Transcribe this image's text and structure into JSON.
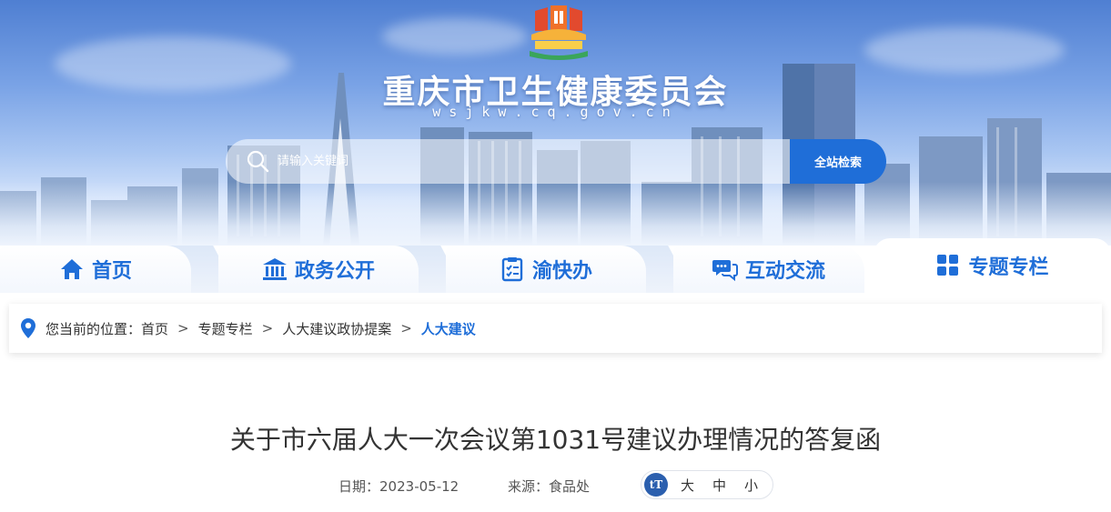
{
  "header": {
    "title": "重庆市卫生健康委员会",
    "domain": "wsjkw.cq.gov.cn"
  },
  "search": {
    "placeholder": "请输入关键词",
    "button_label": "全站检索"
  },
  "nav": {
    "items": [
      {
        "label": "首页",
        "icon": "home-icon"
      },
      {
        "label": "政务公开",
        "icon": "government-building-icon"
      },
      {
        "label": "渝快办",
        "icon": "checklist-icon"
      },
      {
        "label": "互动交流",
        "icon": "chat-bubbles-icon"
      },
      {
        "label": "专题专栏",
        "icon": "grid-icon",
        "active": true
      }
    ]
  },
  "breadcrumb": {
    "prefix": "您当前的位置：",
    "items": [
      "首页",
      "专题专栏",
      "人大建议政协提案",
      "人大建议"
    ],
    "separator": ">"
  },
  "article": {
    "title": "关于市六届人大一次会议第1031号建议办理情况的答复函",
    "date_label": "日期：",
    "date": "2023-05-12",
    "source_label": "来源：",
    "source": "食品处"
  },
  "font_size": {
    "icon_label": "tT",
    "options": [
      "大",
      "中",
      "小"
    ]
  },
  "colors": {
    "accent": "#1f6ed8",
    "banner_top": "#4f7fd2",
    "text": "#333333"
  }
}
